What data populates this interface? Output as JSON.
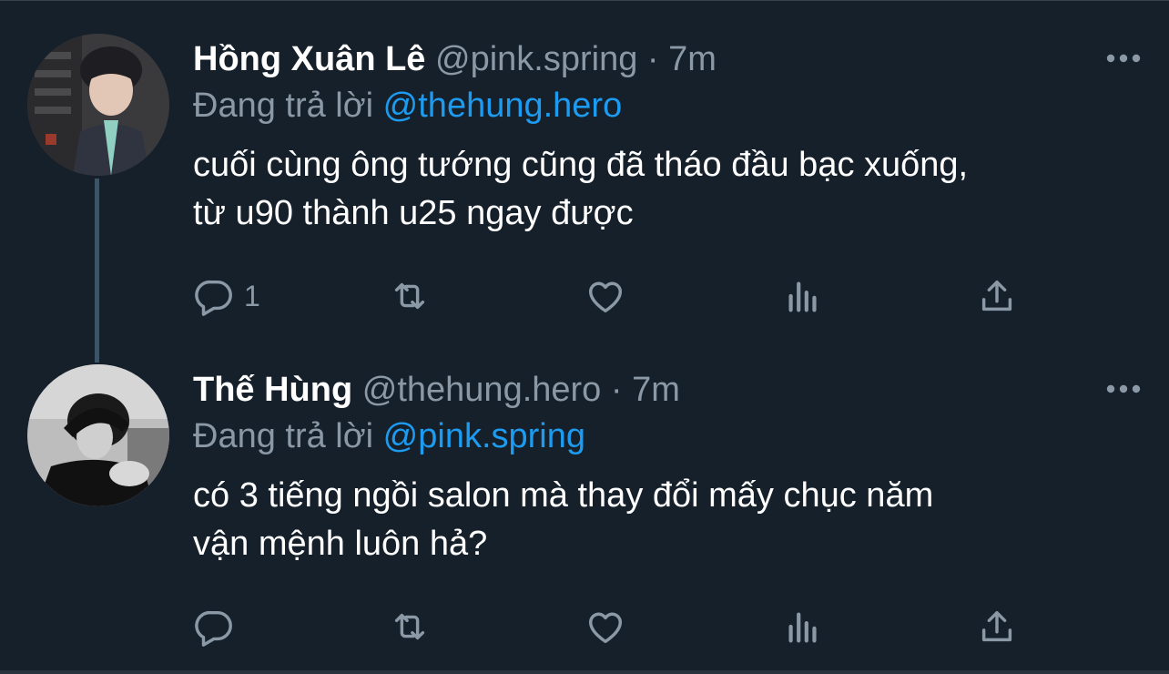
{
  "tweets": [
    {
      "name": "Hồng Xuân Lê",
      "handle": "@pink.spring",
      "separator": "·",
      "time": "7m",
      "replying_label": "Đang trả lời",
      "replying_to": "@thehung.hero",
      "text_line1": "cuối cùng ông tướng cũng đã tháo đầu bạc xuống,",
      "text_line2": "từ u90 thành u25 ngay được",
      "reply_count": "1"
    },
    {
      "name": "Thế Hùng",
      "handle": "@thehung.hero",
      "separator": "·",
      "time": "7m",
      "replying_label": "Đang trả lời",
      "replying_to": "@pink.spring",
      "text_line1": "có 3 tiếng ngồi salon mà thay đổi mấy chục năm",
      "text_line2": "vận mệnh luôn hả?",
      "reply_count": ""
    }
  ],
  "icons": {
    "more": "more-dots-icon",
    "reply": "reply-bubble-icon",
    "retweet": "retweet-icon",
    "like": "heart-icon",
    "analytics": "analytics-bars-icon",
    "share": "share-upload-icon"
  },
  "colors": {
    "background": "#15202b",
    "name": "#ffffff",
    "secondary": "#8b98a5",
    "mention": "#1d9bf0",
    "thread_line": "#3d5466"
  }
}
